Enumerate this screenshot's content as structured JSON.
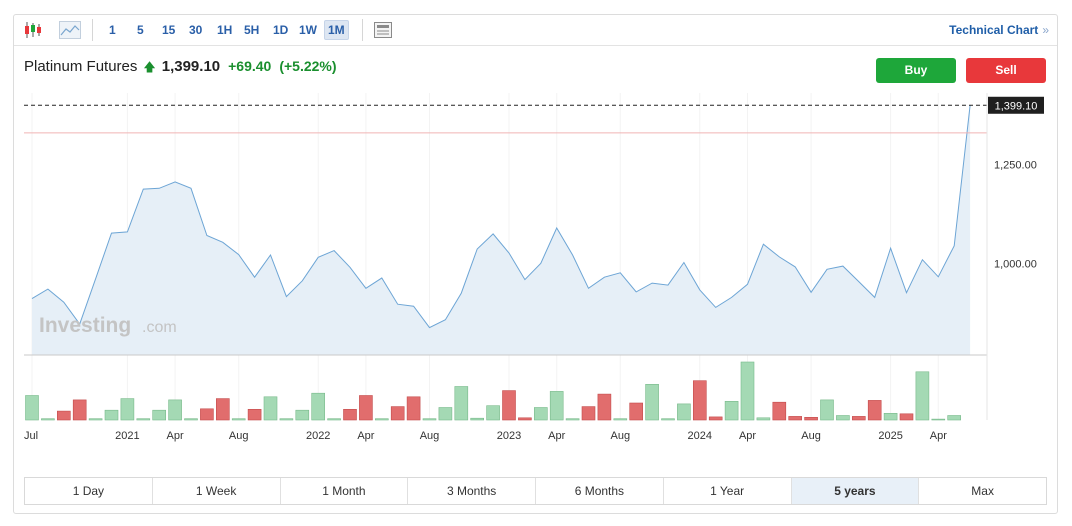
{
  "toolbar": {
    "intervals": [
      "1",
      "5",
      "15",
      "30",
      "1H",
      "5H",
      "1D",
      "1W",
      "1M"
    ],
    "active_interval": "1M",
    "technical_chart_label": "Technical Chart",
    "technical_chart_chevron": "»"
  },
  "quote": {
    "name": "Platinum Futures",
    "price": "1,399.10",
    "change": "+69.40",
    "change_pct": "(+5.22%)",
    "direction_icon": "up-arrow-icon"
  },
  "actions": {
    "buy_label": "Buy",
    "sell_label": "Sell"
  },
  "watermark": {
    "brand": "Investing",
    "suffix": ".com"
  },
  "ranges": [
    "1 Day",
    "1 Week",
    "1 Month",
    "3 Months",
    "6 Months",
    "1 Year",
    "5 years",
    "Max"
  ],
  "active_range": "5 years",
  "colors": {
    "line": "#6da5d5",
    "area": "#e6eff7",
    "volume_up": "#a4d9b4",
    "volume_down": "#e16d6d",
    "positive": "#1a8f2e",
    "buy": "#1ea73a",
    "sell": "#e8383b",
    "reference_line": "#f0b4b4",
    "price_tag_bg": "#1f1f1f"
  },
  "chart_data": {
    "type": "area",
    "y_ticks": [
      "1,250.00",
      "1,000.00"
    ],
    "y_tick_values": [
      1250,
      1000
    ],
    "ylim": [
      770,
      1430
    ],
    "x_tick_labels": [
      "Jul",
      "2021",
      "Apr",
      "Aug",
      "2022",
      "Apr",
      "Aug",
      "2023",
      "Apr",
      "Aug",
      "2024",
      "Apr",
      "Aug",
      "2025",
      "Apr"
    ],
    "x_tick_index": [
      0,
      6,
      9,
      13,
      18,
      21,
      25,
      30,
      33,
      37,
      42,
      45,
      49,
      54,
      57
    ],
    "last_price_label": "1,399.10",
    "last_price": 1399.1,
    "reference_price": 1329.7,
    "months": 60,
    "close": [
      912,
      936,
      903,
      848,
      962,
      1077,
      1080,
      1188,
      1190,
      1206,
      1190,
      1071,
      1054,
      1023,
      966,
      1022,
      917,
      957,
      1016,
      1033,
      991,
      938,
      964,
      898,
      893,
      839,
      859,
      926,
      1037,
      1075,
      1027,
      960,
      1001,
      1090,
      1022,
      938,
      966,
      977,
      929,
      951,
      946,
      1003,
      934,
      890,
      915,
      948,
      1049,
      1017,
      992,
      928,
      986,
      994,
      955,
      915,
      1039,
      927,
      1010,
      967,
      1045,
      1399.1
    ],
    "volume": [
      55,
      3,
      20,
      45,
      3,
      22,
      48,
      3,
      22,
      45,
      3,
      25,
      48,
      3,
      24,
      52,
      3,
      22,
      60,
      3,
      24,
      55,
      3,
      30,
      52,
      3,
      28,
      75,
      4,
      32,
      66,
      5,
      28,
      64,
      3,
      30,
      58,
      3,
      38,
      80,
      3,
      36,
      88,
      7,
      42,
      130,
      5,
      40,
      8,
      6,
      45,
      10,
      8,
      44,
      15,
      14,
      108,
      2,
      10,
      0
    ],
    "volume_up": [
      true,
      true,
      false,
      false,
      true,
      true,
      true,
      true,
      true,
      true,
      true,
      false,
      false,
      true,
      false,
      true,
      true,
      true,
      true,
      true,
      false,
      false,
      true,
      false,
      false,
      true,
      true,
      true,
      true,
      true,
      false,
      false,
      true,
      true,
      true,
      false,
      false,
      true,
      false,
      true,
      true,
      true,
      false,
      false,
      true,
      true,
      true,
      false,
      false,
      false,
      true,
      true,
      false,
      false,
      true,
      false,
      true,
      true,
      true,
      true
    ]
  }
}
